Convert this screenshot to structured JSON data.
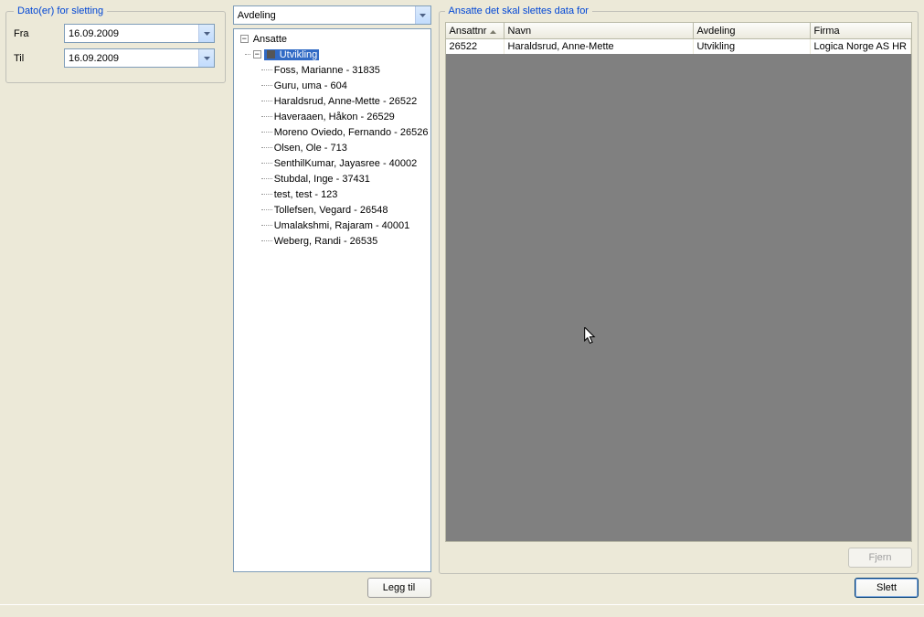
{
  "dates": {
    "legend": "Dato(er) for sletting",
    "fra_label": "Fra",
    "til_label": "Til",
    "fra_value": "16.09.2009",
    "til_value": "16.09.2009"
  },
  "dept_filter": {
    "value": "Avdeling"
  },
  "tree": {
    "root_label": "Ansatte",
    "selected_label": "Utvikling",
    "items": [
      "Foss, Marianne - 31835",
      "Guru, uma - 604",
      "Haraldsrud, Anne-Mette - 26522",
      "Haveraaen, Håkon - 26529",
      "Moreno Oviedo, Fernando - 26526",
      "Olsen, Ole - 713",
      "SenthilKumar, Jayasree - 40002",
      "Stubdal, Inge - 37431",
      "test, test - 123",
      "Tollefsen, Vegard - 26548",
      "Umalakshmi, Rajaram - 40001",
      "Weberg, Randi - 26535"
    ]
  },
  "buttons": {
    "legg_til": "Legg til",
    "fjern": "Fjern",
    "slett": "Slett"
  },
  "grid": {
    "legend": "Ansatte det skal slettes data for",
    "headers": {
      "ansattnr": "Ansattnr",
      "navn": "Navn",
      "avdeling": "Avdeling",
      "firma": "Firma"
    },
    "rows": [
      {
        "ansattnr": "26522",
        "navn": "Haraldsrud, Anne-Mette",
        "avdeling": "Utvikling",
        "firma": "Logica Norge AS HR"
      }
    ]
  }
}
